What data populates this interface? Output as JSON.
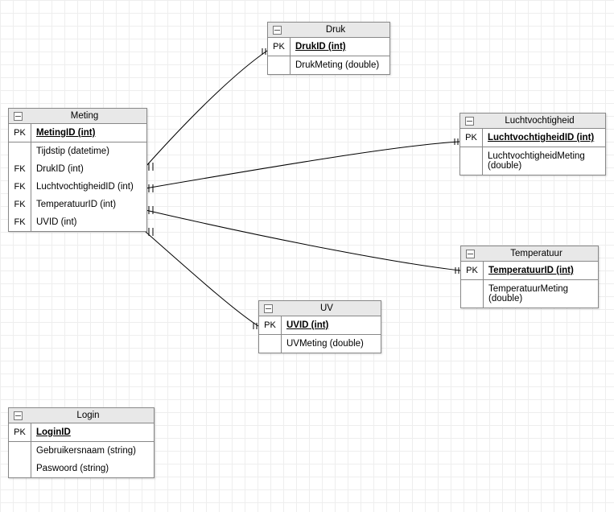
{
  "entities": {
    "meting": {
      "title": "Meting",
      "rows": [
        {
          "key": "PK",
          "attr": "MetingID (int)",
          "pk": true,
          "divider": false
        },
        {
          "key": "",
          "attr": "Tijdstip (datetime)",
          "pk": false,
          "divider": true
        },
        {
          "key": "FK",
          "attr": "DrukID (int)",
          "pk": false,
          "divider": false
        },
        {
          "key": "FK",
          "attr": "LuchtvochtigheidID (int)",
          "pk": false,
          "divider": false
        },
        {
          "key": "FK",
          "attr": "TemperatuurID (int)",
          "pk": false,
          "divider": false
        },
        {
          "key": "FK",
          "attr": "UVID (int)",
          "pk": false,
          "divider": false
        }
      ]
    },
    "druk": {
      "title": "Druk",
      "rows": [
        {
          "key": "PK",
          "attr": "DrukID (int)",
          "pk": true,
          "divider": false
        },
        {
          "key": "",
          "attr": "DrukMeting (double)",
          "pk": false,
          "divider": true
        }
      ]
    },
    "luchtvochtigheid": {
      "title": "Luchtvochtigheid",
      "rows": [
        {
          "key": "PK",
          "attr": "LuchtvochtigheidID (int)",
          "pk": true,
          "divider": false
        },
        {
          "key": "",
          "attr": "LuchtvochtigheidMeting (double)",
          "pk": false,
          "divider": true
        }
      ]
    },
    "temperatuur": {
      "title": "Temperatuur",
      "rows": [
        {
          "key": "PK",
          "attr": "TemperatuurID (int)",
          "pk": true,
          "divider": false
        },
        {
          "key": "",
          "attr": "TemperatuurMeting (double)",
          "pk": false,
          "divider": true
        }
      ]
    },
    "uv": {
      "title": "UV",
      "rows": [
        {
          "key": "PK",
          "attr": "UVID (int)",
          "pk": true,
          "divider": false
        },
        {
          "key": "",
          "attr": "UVMeting (double)",
          "pk": false,
          "divider": true
        }
      ]
    },
    "login": {
      "title": "Login",
      "rows": [
        {
          "key": "PK",
          "attr": "LoginID",
          "pk": true,
          "divider": false
        },
        {
          "key": "",
          "attr": "Gebruikersnaam (string)",
          "pk": false,
          "divider": true
        },
        {
          "key": "",
          "attr": "Paswoord (string)",
          "pk": false,
          "divider": false
        }
      ]
    }
  }
}
